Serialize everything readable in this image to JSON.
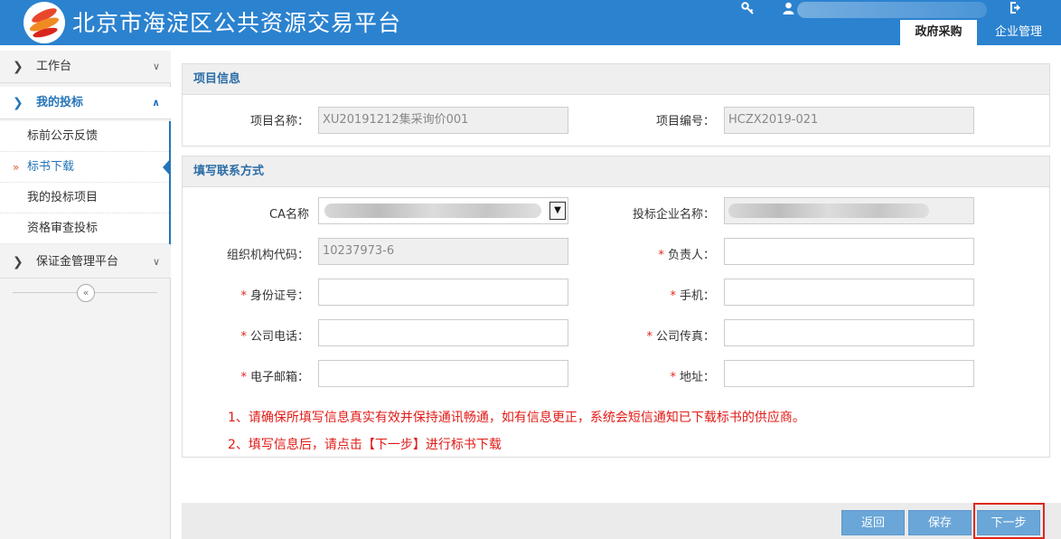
{
  "header": {
    "site_title": "北京市海淀区公共资源交易平台",
    "icons": [
      "key-icon",
      "user-icon",
      "logout-icon"
    ],
    "tabs": [
      {
        "label": "政府采购",
        "active": true
      },
      {
        "label": "企业管理",
        "active": false
      }
    ],
    "brand_color": "#2b82cf"
  },
  "sidebar": {
    "items": [
      {
        "label": "工作台",
        "expanded": false
      },
      {
        "label": "我的投标",
        "expanded": true,
        "children": [
          {
            "label": "标前公示反馈"
          },
          {
            "label": "标书下载",
            "current": true
          },
          {
            "label": "我的投标项目"
          },
          {
            "label": "资格审查投标"
          }
        ]
      },
      {
        "label": "保证金管理平台",
        "expanded": false
      }
    ],
    "collapse_glyph": "«"
  },
  "project_info": {
    "title": "项目信息",
    "name_label": "项目名称：",
    "name_value": "XU20191212集采询价001",
    "number_label": "项目编号：",
    "number_value": "HCZX2019-021"
  },
  "contact": {
    "title": "填写联系方式",
    "ca_label": "CA名称",
    "company_label": "投标企业名称：",
    "org_code_label": "组织机构代码：",
    "org_code_value": "10237973-6",
    "leader_label": "负责人：",
    "id_label": "身份证号：",
    "mobile_label": "手机：",
    "phone_label": "公司电话：",
    "fax_label": "公司传真：",
    "email_label": "电子邮箱：",
    "address_label": "地址：",
    "required_mark": "*",
    "notice_1": "1、请确保所填写信息真实有效并保持通讯畅通，如有信息更正，系统会短信通知已下载标书的供应商。",
    "notice_2": "2、填写信息后，请点击【下一步】进行标书下载"
  },
  "actions": {
    "back": "返回",
    "save": "保存",
    "next": "下一步"
  }
}
